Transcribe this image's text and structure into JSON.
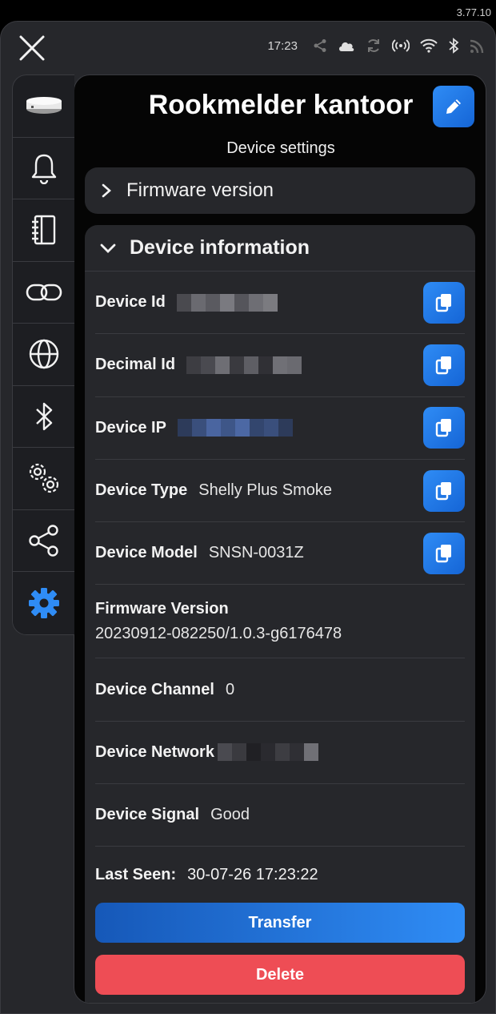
{
  "app_version": "3.77.10",
  "status_bar": {
    "time": "17:23"
  },
  "header": {
    "title": "Rookmelder kantoor",
    "subtitle": "Device settings"
  },
  "firmware_section": {
    "label": "Firmware version"
  },
  "device_info": {
    "title": "Device information",
    "device_id": {
      "label": "Device Id"
    },
    "decimal_id": {
      "label": "Decimal Id"
    },
    "device_ip": {
      "label": "Device IP"
    },
    "device_type": {
      "label": "Device Type",
      "value": "Shelly Plus Smoke"
    },
    "device_model": {
      "label": "Device Model",
      "value": "SNSN-0031Z"
    },
    "firmware_version": {
      "label": "Firmware Version",
      "value": "20230912-082250/1.0.3-g6176478"
    },
    "device_channel": {
      "label": "Device Channel",
      "value": "0"
    },
    "device_network": {
      "label": "Device Network"
    },
    "device_signal": {
      "label": "Device Signal",
      "value": "Good"
    },
    "last_seen": {
      "label": "Last Seen:",
      "value": "30-07-26 17:23:22"
    }
  },
  "buttons": {
    "transfer": "Transfer",
    "delete": "Delete"
  },
  "sidebar": {
    "items": [
      {
        "icon": "device-icon"
      },
      {
        "icon": "bell-icon"
      },
      {
        "icon": "notebook-icon"
      },
      {
        "icon": "link-icon"
      },
      {
        "icon": "globe-icon"
      },
      {
        "icon": "bluetooth-icon"
      },
      {
        "icon": "gears-icon"
      },
      {
        "icon": "share-icon"
      },
      {
        "icon": "settings-icon"
      }
    ]
  },
  "colors": {
    "accent": "#2f8cf5",
    "danger": "#ee4d55",
    "card": "#26272b"
  }
}
